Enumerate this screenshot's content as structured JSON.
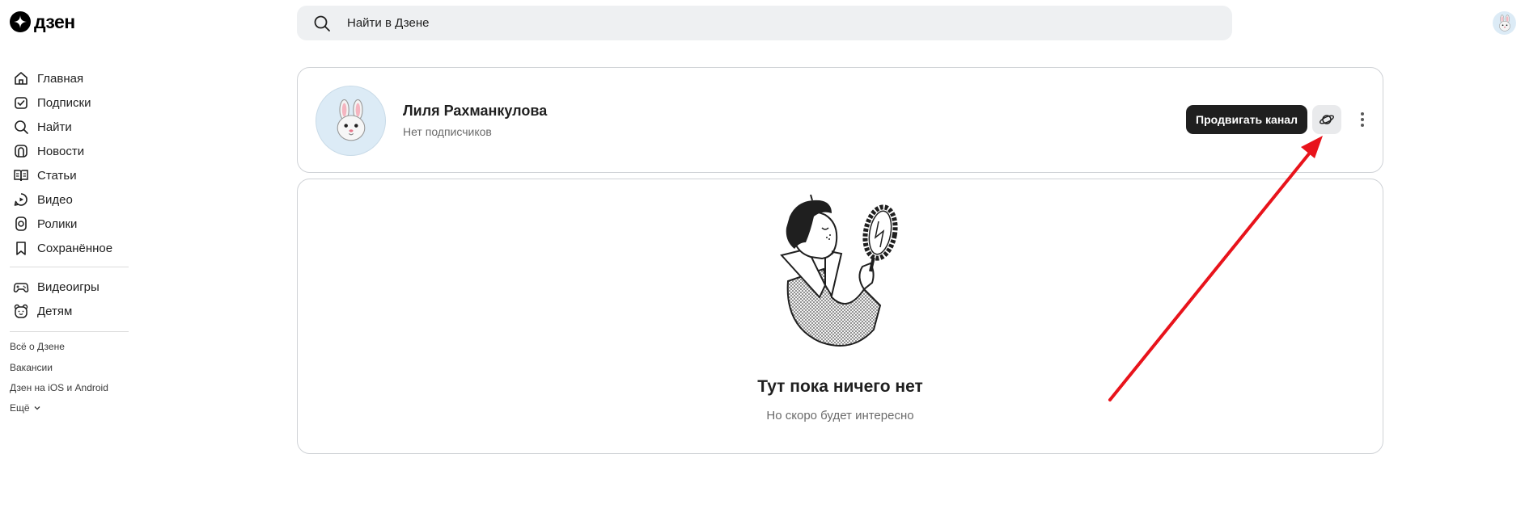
{
  "header": {
    "logo_text": "дзен",
    "search_placeholder": "Найти в Дзене"
  },
  "sidebar": {
    "items": [
      {
        "label": "Главная",
        "icon": "home-icon"
      },
      {
        "label": "Подписки",
        "icon": "subscriptions-icon"
      },
      {
        "label": "Найти",
        "icon": "search-icon"
      },
      {
        "label": "Новости",
        "icon": "news-icon"
      },
      {
        "label": "Статьи",
        "icon": "articles-icon"
      },
      {
        "label": "Видео",
        "icon": "video-icon"
      },
      {
        "label": "Ролики",
        "icon": "shorts-icon"
      },
      {
        "label": "Сохранённое",
        "icon": "bookmark-icon"
      }
    ],
    "extra_items": [
      {
        "label": "Видеоигры",
        "icon": "gamepad-icon"
      },
      {
        "label": "Детям",
        "icon": "kids-icon"
      }
    ],
    "footer_links": [
      "Всё о Дзене",
      "Вакансии",
      "Дзен на iOS и Android",
      "Ещё"
    ]
  },
  "channel": {
    "name": "Лиля Рахманкулова",
    "subscribers": "Нет подписчиков",
    "promote_label": "Продвигать канал"
  },
  "empty_state": {
    "title": "Тут пока ничего нет",
    "subtitle": "Но скоро будет интересно"
  },
  "colors": {
    "accent_dark": "#1f1f1f",
    "annotation_arrow": "#e8131b"
  }
}
